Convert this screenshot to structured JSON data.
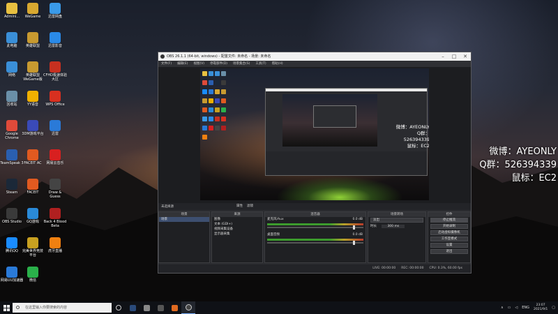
{
  "desktop": {
    "icons_col1": [
      {
        "label": "Admini...",
        "color": "#e8c040"
      },
      {
        "label": "此电脑",
        "color": "#3a8fd8"
      },
      {
        "label": "网络",
        "color": "#3a8fd8"
      },
      {
        "label": "回收站",
        "color": "#6a8fa8"
      },
      {
        "label": "Google Chrome",
        "color": "#e04a3a"
      },
      {
        "label": "TeamSpeak 3",
        "color": "#2a5fb0"
      },
      {
        "label": "Steam",
        "color": "#1b2838"
      },
      {
        "label": "OBS Studio",
        "color": "#3a3a3a"
      },
      {
        "label": "腾讯QQ",
        "color": "#1a8cff"
      },
      {
        "label": "网易UU加速器",
        "color": "#2a7ad8"
      }
    ],
    "icons_col2": [
      {
        "label": "WeGame",
        "color": "#d8a830"
      },
      {
        "label": "英雄联盟",
        "color": "#c89a30"
      },
      {
        "label": "英雄联盟WeGame版",
        "color": "#c89a30"
      },
      {
        "label": "YY语音",
        "color": "#f0b000"
      },
      {
        "label": "3DM游戏平台",
        "color": "#3a4ab8"
      },
      {
        "label": "FACEIT AC",
        "color": "#e05a20"
      },
      {
        "label": "FACEIT",
        "color": "#e05a20"
      },
      {
        "label": "GQ游戏",
        "color": "#2a8ad8"
      },
      {
        "label": "完美世界竞技平台",
        "color": "#c8a020"
      },
      {
        "label": "微信",
        "color": "#2ab04a"
      }
    ],
    "icons_col3": [
      {
        "label": "迅雷网盘",
        "color": "#3a9ae8"
      },
      {
        "label": "迅雷影音",
        "color": "#2a8ae8"
      },
      {
        "label": "CFHD极速体验大区",
        "color": "#c83020"
      },
      {
        "label": "WPS Office",
        "color": "#d83020"
      },
      {
        "label": "迅雷",
        "color": "#2a7ad8"
      },
      {
        "label": "网易云音乐",
        "color": "#d82020"
      },
      {
        "label": "Draw & Guess",
        "color": "#444"
      },
      {
        "label": "Back 4 Blood Beta",
        "color": "#b02020"
      },
      {
        "label": "虎牙直播",
        "color": "#f08010"
      }
    ]
  },
  "overlay": {
    "line1": "微博：AYEONLY",
    "line2": "Q群：526394339",
    "line3": "鼠标：EC2"
  },
  "obs": {
    "title": "OBS 26.1.1 (64-bit, windows) - 配置文件: 未命名 - 场景: 未命名",
    "menu": [
      "文件(F)",
      "编辑(E)",
      "视图(V)",
      "停靠部件(D)",
      "场景集合(S)",
      "工具(T)",
      "帮助(H)"
    ],
    "scene_label": "未选择源",
    "tab_properties": "属性",
    "tab_filters": "滤镜",
    "panels": {
      "scenes": {
        "title": "场景",
        "items": [
          "场景"
        ]
      },
      "sources": {
        "title": "来源",
        "items": [
          "图像",
          "文本 (GDI+)",
          "视频采集设备",
          "显示器采集"
        ]
      },
      "mixer": {
        "title": "混音器",
        "channels": [
          {
            "name": "麦克风/Aux",
            "level": "0.0 dB"
          },
          {
            "name": "桌面音频",
            "level": "0.0 dB"
          }
        ]
      },
      "transitions": {
        "title": "场景转场",
        "type": "淡出",
        "duration_label": "时长",
        "duration": "300 ms"
      },
      "controls": {
        "title": "控件",
        "buttons": [
          "停止推流",
          "开始录制",
          "启动虚拟摄像机",
          "工作室模式",
          "设置",
          "退出"
        ]
      }
    },
    "status": {
      "live": "LIVE: 00:00:00",
      "rec": "REC: 00:00:00",
      "cpu": "CPU: 0.3%, 60.00 fps"
    }
  },
  "taskbar": {
    "search_placeholder": "在这里输入你要搜索的内容",
    "lang": "ENG",
    "time": "23:07",
    "date": "2021/9/1"
  },
  "colors": {
    "obs_bg": "#2a2b2f",
    "accent": "#3d4f70",
    "taskbar": "#0f1116"
  }
}
